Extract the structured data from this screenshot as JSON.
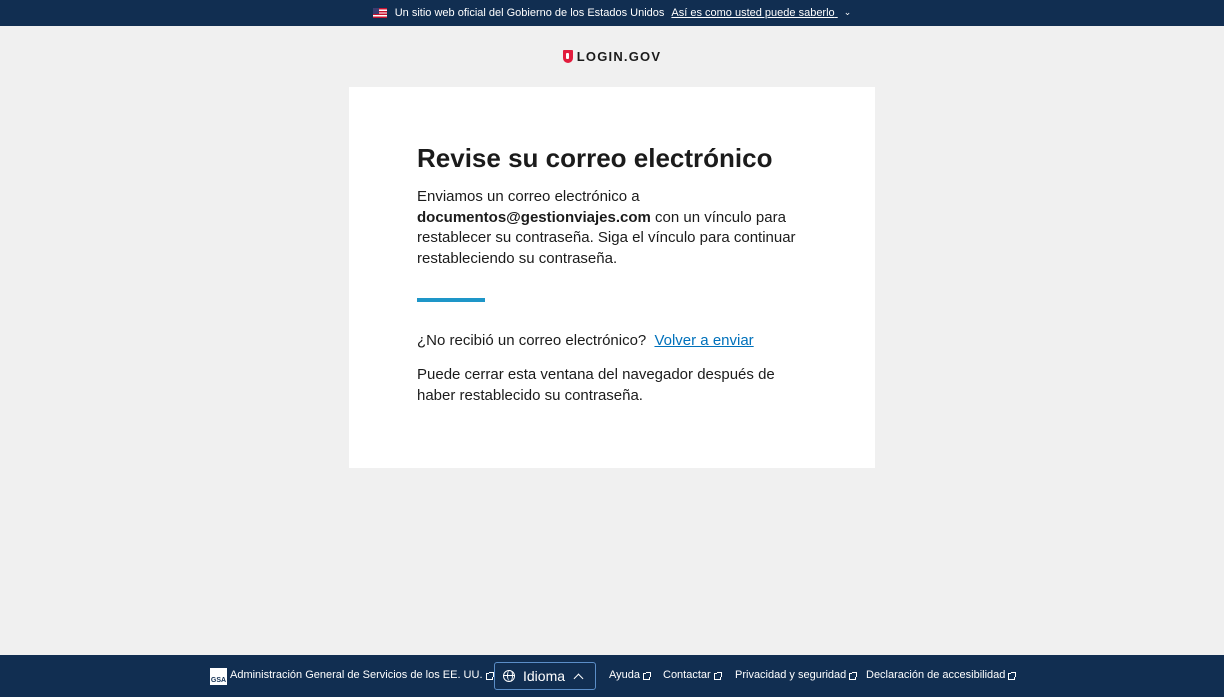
{
  "banner": {
    "text": "Un sitio web oficial del Gobierno de los Estados Unidos",
    "link": "Así es como usted puede saberlo"
  },
  "logo": {
    "text": "LOGIN.GOV"
  },
  "card": {
    "title": "Revise su correo electrónico",
    "body_prefix": "Enviamos un correo electrónico a",
    "email": "documentos@gestionviajes.com",
    "body_suffix": "con un vínculo para restablecer su contraseña. Siga el vínculo para continuar restableciendo su contraseña.",
    "resend_question": "¿No recibió un correo electrónico?",
    "resend_link": "Volver a enviar",
    "close_text": "Puede cerrar esta ventana del navegador después de haber restablecido su contraseña."
  },
  "footer": {
    "gsa_logo": "GSA",
    "agency": "Administración General de Servicios de los EE. UU.",
    "language_label": "Idioma",
    "links": [
      "Ayuda",
      "Contactar",
      "Privacidad y seguridad",
      "Declaración de accesibilidad"
    ]
  },
  "colors": {
    "navy": "#112e51",
    "accent": "#1e96c8",
    "link": "#0071bb",
    "logo_red": "#e21c3d"
  }
}
